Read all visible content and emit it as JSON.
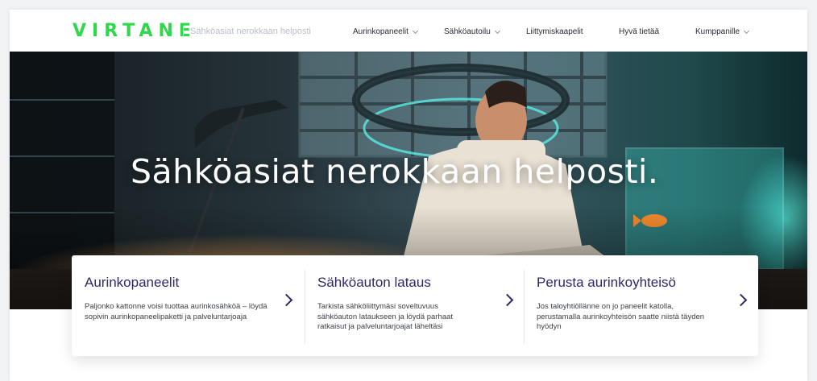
{
  "brand": {
    "logo": "VIRTANE",
    "tagline": "Sähköasiat nerokkaan helposti",
    "color": "#2fd84b"
  },
  "nav": {
    "items": [
      {
        "label": "Aurinkopaneelit",
        "has_dropdown": true
      },
      {
        "label": "Sähköautoilu",
        "has_dropdown": true
      },
      {
        "label": "Liittymiskaapelit",
        "has_dropdown": false
      },
      {
        "label": "Hyvä tietää",
        "has_dropdown": false
      },
      {
        "label": "Kumppanille",
        "has_dropdown": true
      }
    ]
  },
  "hero": {
    "title": "Sähköasiat nerokkaan helposti."
  },
  "cards": [
    {
      "title": "Aurinkopaneelit",
      "text": "Paljonko kattonne voisi tuottaa aurinkosähköä – löydä sopivin aurinkopaneelipaketti ja palveluntarjoaja",
      "arrow_icon": "chevron-right-icon"
    },
    {
      "title": "Sähköauton lataus",
      "text": "Tarkista sähköliittymäsi soveltuvuus sähköauton lataukseen ja löydä parhaat ratkaisut ja palveluntarjoajat läheltäsi",
      "arrow_icon": "chevron-right-icon"
    },
    {
      "title": "Perusta aurinkoyhteisö",
      "text": "Jos taloyhtiöllänne on jo paneelit katolla, perustamalla aurinkoyhteisön saatte niistä täyden hyödyn",
      "arrow_icon": "chevron-right-icon"
    }
  ],
  "colors": {
    "accent_green": "#2fd84b",
    "card_title": "#322569"
  }
}
